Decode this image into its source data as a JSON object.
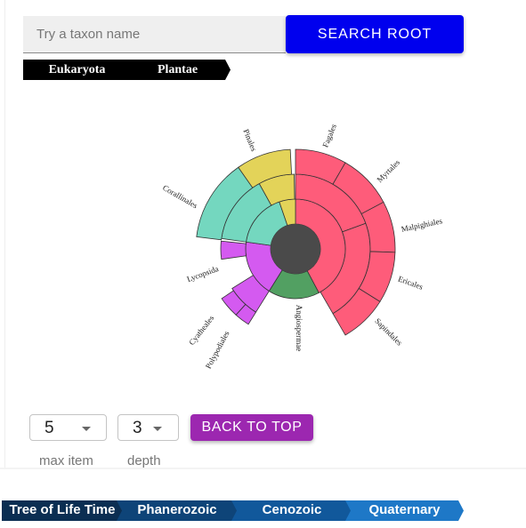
{
  "search": {
    "placeholder": "Try a taxon name",
    "value": "",
    "button_label": "SEARCH ROOT"
  },
  "breadcrumb": [
    {
      "label": "Eukaryota"
    },
    {
      "label": "Plantae"
    }
  ],
  "sunburst": {
    "colors": {
      "center": "#4a4a4a",
      "pink": "#fe5c7a",
      "yellow": "#e3d359",
      "teal": "#74d7bf",
      "purple": "#d45af0",
      "green": "#52a062",
      "stroke": "#333333"
    },
    "labels": [
      {
        "text": "Pinales"
      },
      {
        "text": "Fagales"
      },
      {
        "text": "Myrtales"
      },
      {
        "text": "Corallinales"
      },
      {
        "text": "Malpighiales"
      },
      {
        "text": "Ericales"
      },
      {
        "text": "Lycopsida"
      },
      {
        "text": "Sapindales"
      },
      {
        "text": "Angiospermae"
      },
      {
        "text": "Cyatheales"
      },
      {
        "text": "Polypodiales"
      }
    ]
  },
  "controls": {
    "max_item": {
      "value": "5",
      "label": "max item"
    },
    "depth": {
      "value": "3",
      "label": "depth"
    },
    "back_label": "BACK TO TOP"
  },
  "timeline": {
    "items": [
      {
        "label": "Tree of Life Time",
        "color": "#0b2e52"
      },
      {
        "label": "Phanerozoic",
        "color": "#0e4478"
      },
      {
        "label": "Cenozoic",
        "color": "#11589b"
      },
      {
        "label": "Quaternary",
        "color": "#1e78c7"
      }
    ]
  }
}
